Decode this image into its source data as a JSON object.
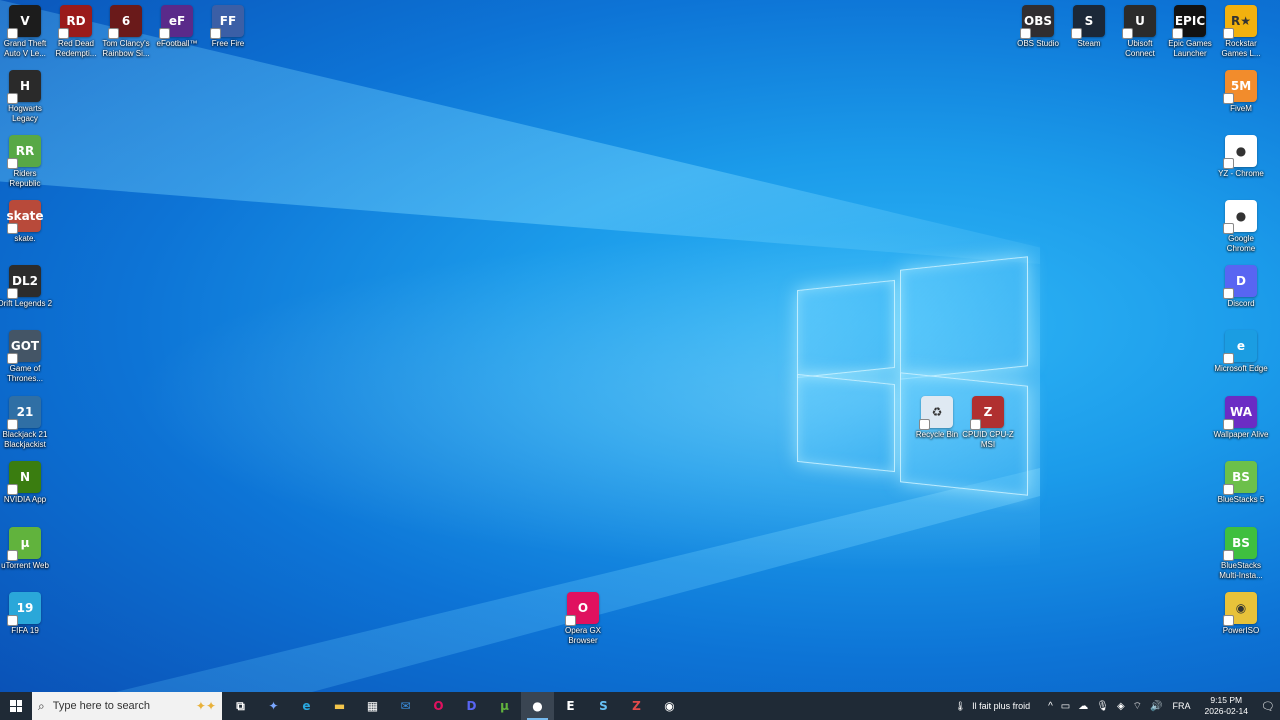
{
  "desktop": {
    "left_column": [
      {
        "label": "Grand Theft Auto V Le...",
        "badge": "V",
        "color": "#1c1c1c",
        "icon": "gta-v-icon"
      },
      {
        "label": "Hogwarts Legacy",
        "badge": "H",
        "color": "#2a2a2a",
        "icon": "hogwarts-legacy-icon"
      },
      {
        "label": "Riders Republic",
        "badge": "RR",
        "color": "#58a846",
        "icon": "riders-republic-icon"
      },
      {
        "label": "skate.",
        "badge": "skate",
        "color": "#b84a3a",
        "icon": "skate-icon"
      },
      {
        "label": "Drift Legends 2",
        "badge": "DL2",
        "color": "#2c2c2c",
        "icon": "drift-legends-icon"
      },
      {
        "label": "Game of Thrones...",
        "badge": "GOT",
        "color": "#445566",
        "icon": "game-of-thrones-icon"
      },
      {
        "label": "Blackjack 21 Blackjackist",
        "badge": "21",
        "color": "#2f6fa5",
        "icon": "blackjack-icon"
      },
      {
        "label": "NVIDIA App",
        "badge": "N",
        "color": "#3a7d10",
        "icon": "nvidia-icon"
      },
      {
        "label": "uTorrent Web",
        "badge": "µ",
        "color": "#61b33d",
        "icon": "utorrent-icon"
      },
      {
        "label": "FIFA 19",
        "badge": "19",
        "color": "#2aa7d9",
        "icon": "fifa-icon"
      }
    ],
    "top_row": [
      {
        "label": "Red Dead Redempti...",
        "badge": "RD",
        "color": "#9a1b1b",
        "icon": "red-dead-icon"
      },
      {
        "label": "Tom Clancy's Rainbow Si...",
        "badge": "6",
        "color": "#6a1a1a",
        "icon": "rainbow-six-icon"
      },
      {
        "label": "eFootball™",
        "badge": "eF",
        "color": "#5a2a8a",
        "icon": "efootball-icon"
      },
      {
        "label": "Free Fire",
        "badge": "FF",
        "color": "#3b5fa6",
        "icon": "free-fire-icon"
      }
    ],
    "right_top_row": [
      {
        "label": "OBS Studio",
        "badge": "OBS",
        "color": "#302e31",
        "icon": "obs-icon"
      },
      {
        "label": "Steam",
        "badge": "S",
        "color": "#1b2838",
        "icon": "steam-icon"
      },
      {
        "label": "Ubisoft Connect",
        "badge": "U",
        "color": "#2b2b2b",
        "icon": "ubisoft-icon"
      },
      {
        "label": "Epic Games Launcher",
        "badge": "EPIC",
        "color": "#121212",
        "icon": "epic-games-icon"
      },
      {
        "label": "Rockstar Games L...",
        "badge": "R★",
        "color": "#f2b10e",
        "icon": "rockstar-icon"
      }
    ],
    "right_column": [
      {
        "label": "FiveM",
        "badge": "5M",
        "color": "#f28c2c",
        "icon": "fivem-icon"
      },
      {
        "label": "YZ - Chrome",
        "badge": "●",
        "color": "#ffffff",
        "icon": "chrome-profile-icon"
      },
      {
        "label": "Google Chrome",
        "badge": "●",
        "color": "#ffffff",
        "icon": "chrome-icon"
      },
      {
        "label": "Discord",
        "badge": "D",
        "color": "#5865f2",
        "icon": "discord-icon"
      },
      {
        "label": "Microsoft Edge",
        "badge": "e",
        "color": "#1b9de2",
        "icon": "edge-icon"
      },
      {
        "label": "Wallpaper Alive",
        "badge": "WA",
        "color": "#6b2cc4",
        "icon": "wallpaper-alive-icon"
      },
      {
        "label": "BlueStacks 5",
        "badge": "BS",
        "color": "#6cc04a",
        "icon": "bluestacks-icon"
      },
      {
        "label": "BlueStacks Multi-Insta...",
        "badge": "BS",
        "color": "#3fbf3f",
        "icon": "bluestacks-multi-icon"
      },
      {
        "label": "PowerISO",
        "badge": "◉",
        "color": "#e8c23a",
        "icon": "poweriso-icon"
      }
    ],
    "center": [
      {
        "label": "Recycle Bin",
        "badge": "♻",
        "color": "#dfe9f2",
        "icon": "recycle-bin-icon"
      },
      {
        "label": "CPUID CPU-Z MSI",
        "badge": "Z",
        "color": "#b03030",
        "icon": "cpu-z-icon"
      },
      {
        "label": "Opera GX Browser",
        "badge": "O",
        "color": "#e0115f",
        "icon": "opera-gx-icon"
      }
    ]
  },
  "taskbar": {
    "search_placeholder": "Type here to search",
    "apps": [
      {
        "icon": "task-view-icon",
        "glyph": "⧉",
        "color": "#ffffff"
      },
      {
        "icon": "copilot-icon",
        "glyph": "✦",
        "color": "#7aa7ff"
      },
      {
        "icon": "edge-icon",
        "glyph": "e",
        "color": "#29a8e0"
      },
      {
        "icon": "file-explorer-icon",
        "glyph": "▬",
        "color": "#f3c54b"
      },
      {
        "icon": "store-icon",
        "glyph": "▦",
        "color": "#ffffff"
      },
      {
        "icon": "mail-icon",
        "glyph": "✉",
        "color": "#3b8fe0"
      },
      {
        "icon": "opera-gx-icon",
        "glyph": "O",
        "color": "#e0115f"
      },
      {
        "icon": "discord-icon",
        "glyph": "D",
        "color": "#5865f2"
      },
      {
        "icon": "utorrent-icon",
        "glyph": "µ",
        "color": "#61b33d"
      },
      {
        "icon": "chrome-icon",
        "glyph": "●",
        "color": "#ffffff"
      },
      {
        "icon": "epic-games-icon",
        "glyph": "E",
        "color": "#ffffff"
      },
      {
        "icon": "steam-icon",
        "glyph": "S",
        "color": "#66c0f4"
      },
      {
        "icon": "cpu-z-icon",
        "glyph": "Z",
        "color": "#e04a4a"
      },
      {
        "icon": "obs-icon",
        "glyph": "◉",
        "color": "#ffffff"
      }
    ],
    "active_app_index": 9,
    "weather_text": "Il fait plus froid",
    "language": "FRA",
    "time": "9:15 PM",
    "date": "2026-02-14"
  }
}
